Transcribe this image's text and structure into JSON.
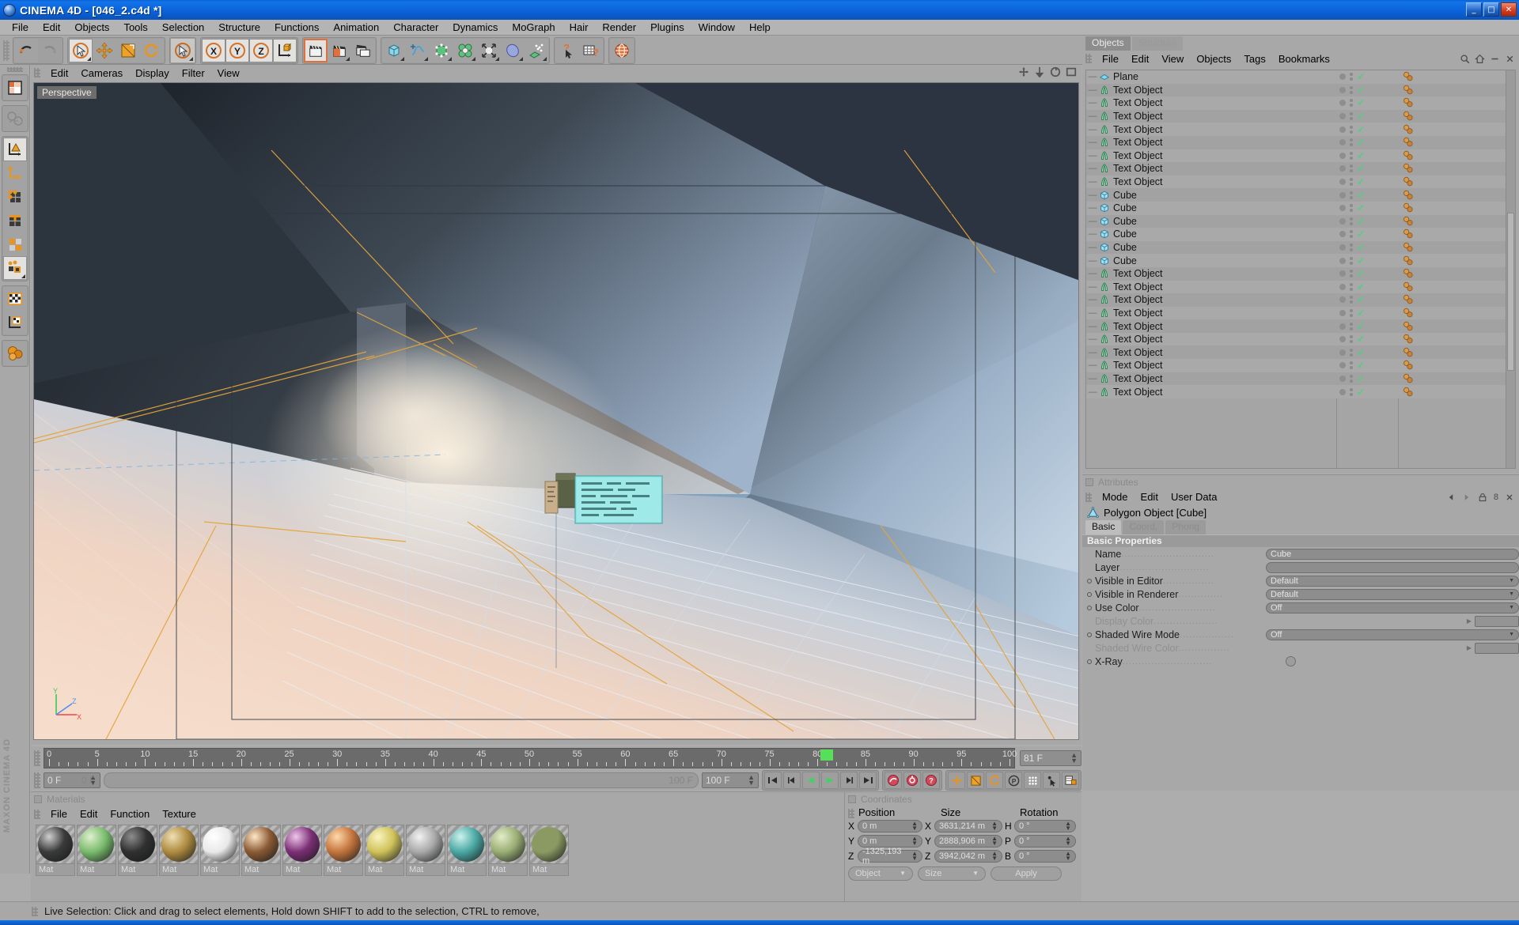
{
  "window": {
    "title": "CINEMA 4D - [046_2.c4d *]",
    "icon": "c4d-sphere-icon",
    "buttons": {
      "minimize": "_",
      "maximize": "□",
      "close": "✕"
    }
  },
  "menubar": {
    "items": [
      "File",
      "Edit",
      "Objects",
      "Tools",
      "Selection",
      "Structure",
      "Functions",
      "Animation",
      "Character",
      "Dynamics",
      "MoGraph",
      "Hair",
      "Render",
      "Plugins",
      "Window",
      "Help"
    ]
  },
  "toolbar": {
    "groups": [
      {
        "name": "history",
        "buttons": [
          {
            "name": "undo-button",
            "icon": "undo-icon",
            "state": "normal"
          },
          {
            "name": "redo-button",
            "icon": "redo-icon",
            "state": "disabled"
          }
        ]
      },
      {
        "name": "selection-tools",
        "buttons": [
          {
            "name": "live-selection-button",
            "icon": "cursor-circle-icon",
            "state": "selected",
            "has_corner": true
          },
          {
            "name": "move-button",
            "icon": "move-arrows-icon",
            "state": "normal"
          },
          {
            "name": "scale-button",
            "icon": "scale-box-icon",
            "state": "normal"
          },
          {
            "name": "rotate-button",
            "icon": "rotate-arrows-icon",
            "state": "normal"
          }
        ]
      },
      {
        "name": "active-tool",
        "buttons": [
          {
            "name": "active-tool-button",
            "icon": "cursor-circle-icon",
            "state": "highlight",
            "has_corner": true
          }
        ]
      },
      {
        "name": "axis-locks",
        "buttons": [
          {
            "name": "lock-x-button",
            "icon": "axis-x-icon",
            "state": "selected"
          },
          {
            "name": "lock-y-button",
            "icon": "axis-y-icon",
            "state": "selected"
          },
          {
            "name": "lock-z-button",
            "icon": "axis-z-icon",
            "state": "selected"
          },
          {
            "name": "world-object-coord-button",
            "icon": "world-axis-cube-icon",
            "state": "selected"
          }
        ]
      },
      {
        "name": "render-tools",
        "buttons": [
          {
            "name": "render-view-button",
            "icon": "clapper-icon",
            "state": "selected"
          },
          {
            "name": "render-region-button",
            "icon": "clapper-region-icon",
            "state": "normal",
            "has_corner": true
          },
          {
            "name": "render-settings-button",
            "icon": "clapper-settings-icon",
            "state": "normal"
          }
        ]
      },
      {
        "name": "primitives",
        "buttons": [
          {
            "name": "cube-primitive-button",
            "icon": "cube-icon",
            "state": "normal",
            "has_corner": true
          },
          {
            "name": "spline-button",
            "icon": "spline-icon",
            "state": "normal",
            "has_corner": true
          },
          {
            "name": "nurbs-button",
            "icon": "hypernurbs-icon",
            "state": "normal",
            "has_corner": true
          },
          {
            "name": "array-button",
            "icon": "array-icon",
            "state": "normal",
            "has_corner": true
          },
          {
            "name": "deformer-button",
            "icon": "deformer-icon",
            "state": "normal",
            "has_corner": true
          },
          {
            "name": "scene-object-button",
            "icon": "scene-floor-icon",
            "state": "normal",
            "has_corner": true
          },
          {
            "name": "particles-button",
            "icon": "particle-emitter-icon",
            "state": "normal",
            "has_corner": true
          }
        ]
      },
      {
        "name": "help-tools",
        "buttons": [
          {
            "name": "help-cursor-button",
            "icon": "question-cursor-icon",
            "state": "normal"
          },
          {
            "name": "structure-help-button",
            "icon": "grid-question-icon",
            "state": "normal"
          }
        ]
      },
      {
        "name": "web",
        "buttons": [
          {
            "name": "online-help-button",
            "icon": "globe-icon",
            "state": "normal"
          }
        ]
      }
    ]
  },
  "left_toolbar": {
    "buttons": [
      {
        "name": "layout-button",
        "icon": "layout-grid-icon",
        "state": "normal"
      },
      {
        "name": "undo-view-button",
        "icon": "ghost-view-icon",
        "state": "disabled"
      },
      {
        "name": "make-editable-button",
        "icon": "make-editable-icon",
        "state": "selected"
      },
      {
        "name": "object-axis-button",
        "icon": "object-axis-icon",
        "state": "normal"
      },
      {
        "name": "point-mode-button",
        "icon": "point-mode-icon",
        "state": "normal"
      },
      {
        "name": "edge-mode-button",
        "icon": "edge-mode-icon",
        "state": "normal"
      },
      {
        "name": "polygon-mode-button",
        "icon": "polygon-mode-icon",
        "state": "normal"
      },
      {
        "name": "uv-mode-button",
        "icon": "uv-mode-icon",
        "state": "selected",
        "has_corner": true
      },
      {
        "name": "texture-mode-button",
        "icon": "texture-checker-icon",
        "state": "normal"
      },
      {
        "name": "texture-axis-button",
        "icon": "texture-axis-icon",
        "state": "normal"
      },
      {
        "name": "viewport-solo-button",
        "icon": "spheres-icon",
        "state": "normal"
      }
    ],
    "branding": "MAXON CINEMA 4D"
  },
  "viewport": {
    "menu": [
      "Edit",
      "Cameras",
      "Display",
      "Filter",
      "View"
    ],
    "label": "Perspective",
    "corner_icons": [
      "pan-icon",
      "dolly-icon",
      "rotate-icon",
      "maximize-icon"
    ],
    "axis_labels": [
      "Y",
      "Z",
      "X"
    ]
  },
  "timeline": {
    "ruler_start": 0,
    "ruler_end": 100,
    "ruler_labels": [
      0,
      5,
      10,
      15,
      20,
      25,
      30,
      35,
      40,
      45,
      50,
      55,
      60,
      65,
      70,
      75,
      80,
      85,
      90,
      95,
      100
    ],
    "current_frame_marker": 81,
    "current_frame_field": "81 F",
    "start_field": "0 F",
    "start_frame_trough": "0 F",
    "end_trough": "100 F",
    "end_field": "100 F",
    "transport_buttons": [
      {
        "name": "go-to-start-button",
        "icon": "skip-back-icon"
      },
      {
        "name": "previous-keyframe-button",
        "icon": "step-back-icon"
      },
      {
        "name": "play-backward-button",
        "icon": "play-back-icon"
      },
      {
        "name": "play-forward-button",
        "icon": "play-forward-icon"
      },
      {
        "name": "next-keyframe-button",
        "icon": "step-forward-icon"
      },
      {
        "name": "go-to-end-button",
        "icon": "skip-forward-icon"
      }
    ],
    "record_buttons": [
      {
        "name": "record-active-objects-button",
        "icon": "record-icon"
      },
      {
        "name": "autokeying-button",
        "icon": "autokey-icon"
      },
      {
        "name": "keyframe-selection-button",
        "icon": "key-selection-icon"
      }
    ],
    "key_option_buttons": [
      {
        "name": "position-key-button",
        "icon": "position-key-icon"
      },
      {
        "name": "scale-key-button",
        "icon": "scale-key-icon"
      },
      {
        "name": "rotation-key-button",
        "icon": "rotation-key-icon"
      },
      {
        "name": "parameter-key-button",
        "icon": "param-key-icon"
      },
      {
        "name": "point-level-animation-button",
        "icon": "pla-icon"
      },
      {
        "name": "auto-keying-toggle",
        "icon": "autokey-cursor-icon"
      },
      {
        "name": "keyframe-mode-button",
        "icon": "keyframe-mode-icon"
      }
    ]
  },
  "materials": {
    "panel_title": "Materials",
    "menu": [
      "File",
      "Edit",
      "Function",
      "Texture"
    ],
    "items": [
      {
        "label": "Mat",
        "color": "#3a3a3a",
        "hl": "#cfcfcf"
      },
      {
        "label": "Mat",
        "color": "#79bb6c",
        "hl": "#dff0cf"
      },
      {
        "label": "Mat",
        "color": "#303030",
        "hl": "#8d8d8d"
      },
      {
        "label": "Mat",
        "color": "#ae8b3f",
        "hl": "#efe0b4"
      },
      {
        "label": "Mat",
        "color": "#e9e9e9",
        "hl": "#ffffff"
      },
      {
        "label": "Mat",
        "color": "#8a5a34",
        "hl": "#ffe7c8"
      },
      {
        "label": "Mat",
        "color": "#7b2f74",
        "hl": "#f0c6ec"
      },
      {
        "label": "Mat",
        "color": "#c3743c",
        "hl": "#ffd9ab"
      },
      {
        "label": "Mat",
        "color": "#cfc25a",
        "hl": "#fbf4c0"
      },
      {
        "label": "Mat",
        "color": "#a9a9a9",
        "hl": "#f2f2f2"
      },
      {
        "label": "Mat",
        "color": "#4aa8a3",
        "hl": "#cdf2ef"
      },
      {
        "label": "Mat",
        "color": "#9aae74",
        "hl": "#e2edc8"
      },
      {
        "label": "Mat",
        "color": "#8b9a62",
        "hl": "#8b9a62"
      }
    ]
  },
  "coordinates": {
    "panel_title": "Coordinates",
    "columns": [
      "Position",
      "Size",
      "Rotation"
    ],
    "position": {
      "x": "0 m",
      "y": "0 m",
      "z": "-1325,193 m"
    },
    "size": {
      "x": "3631,214 m",
      "y": "2888,906 m",
      "z": "3942,042 m"
    },
    "rotation": {
      "h": "0 °",
      "p": "0 °",
      "b": "0 °"
    },
    "labels": {
      "px": "X",
      "py": "Y",
      "pz": "Z",
      "sx": "X",
      "sy": "Y",
      "sz": "Z",
      "rh": "H",
      "rp": "P",
      "rb": "B"
    },
    "mode_dropdown": "Object",
    "size_dropdown": "Size",
    "apply_button": "Apply"
  },
  "objects_panel": {
    "tabs": [
      {
        "label": "Objects",
        "active": true
      },
      {
        "label": "Structure",
        "active": false
      }
    ],
    "menu": [
      "File",
      "Edit",
      "View",
      "Objects",
      "Tags",
      "Bookmarks"
    ],
    "corner_icons": [
      "search-icon",
      "home-icon",
      "minimize-icon",
      "close-icon"
    ],
    "rows": [
      {
        "name": "Plane",
        "icon": "plane-icon"
      },
      {
        "name": "Text Object",
        "icon": "text-object-icon"
      },
      {
        "name": "Text Object",
        "icon": "text-object-icon"
      },
      {
        "name": "Text Object",
        "icon": "text-object-icon"
      },
      {
        "name": "Text Object",
        "icon": "text-object-icon"
      },
      {
        "name": "Text Object",
        "icon": "text-object-icon"
      },
      {
        "name": "Text Object",
        "icon": "text-object-icon"
      },
      {
        "name": "Text Object",
        "icon": "text-object-icon"
      },
      {
        "name": "Text Object",
        "icon": "text-object-icon"
      },
      {
        "name": "Cube",
        "icon": "cube-object-icon"
      },
      {
        "name": "Cube",
        "icon": "cube-object-icon"
      },
      {
        "name": "Cube",
        "icon": "cube-object-icon"
      },
      {
        "name": "Cube",
        "icon": "cube-object-icon"
      },
      {
        "name": "Cube",
        "icon": "cube-object-icon"
      },
      {
        "name": "Cube",
        "icon": "cube-object-icon"
      },
      {
        "name": "Text Object",
        "icon": "text-object-icon"
      },
      {
        "name": "Text Object",
        "icon": "text-object-icon"
      },
      {
        "name": "Text Object",
        "icon": "text-object-icon"
      },
      {
        "name": "Text Object",
        "icon": "text-object-icon"
      },
      {
        "name": "Text Object",
        "icon": "text-object-icon"
      },
      {
        "name": "Text Object",
        "icon": "text-object-icon"
      },
      {
        "name": "Text Object",
        "icon": "text-object-icon"
      },
      {
        "name": "Text Object",
        "icon": "text-object-icon"
      },
      {
        "name": "Text Object",
        "icon": "text-object-icon"
      },
      {
        "name": "Text Object",
        "icon": "text-object-icon"
      }
    ]
  },
  "attributes": {
    "panel_title": "Attributes",
    "menu": [
      "Mode",
      "Edit",
      "User Data"
    ],
    "object_title": "Polygon Object [Cube]",
    "object_icon": "polygon-object-icon",
    "tabs": [
      {
        "label": "Basic",
        "active": true
      },
      {
        "label": "Coord,",
        "active": false
      },
      {
        "label": "Phong",
        "active": false
      }
    ],
    "section": "Basic Properties",
    "properties": [
      {
        "label": "Name",
        "value": "Cube",
        "type": "text",
        "dim": false,
        "bullet": false
      },
      {
        "label": "Layer",
        "value": "",
        "type": "text",
        "dim": false,
        "bullet": false
      },
      {
        "label": "Visible in Editor",
        "value": "Default",
        "type": "dropdown",
        "dim": false,
        "bullet": true
      },
      {
        "label": "Visible in Renderer",
        "value": "Default",
        "type": "dropdown",
        "dim": false,
        "bullet": true
      },
      {
        "label": "Use Color",
        "value": "Off",
        "type": "dropdown",
        "dim": false,
        "bullet": true
      },
      {
        "label": "Display Color",
        "value": "",
        "type": "color",
        "dim": true,
        "bullet": false
      },
      {
        "label": "Shaded Wire Mode",
        "value": "Off",
        "type": "dropdown",
        "dim": false,
        "bullet": true
      },
      {
        "label": "Shaded Wire Color",
        "value": "",
        "type": "color",
        "dim": true,
        "bullet": false
      },
      {
        "label": "X-Ray",
        "value": "",
        "type": "checkbox",
        "dim": false,
        "bullet": true
      }
    ],
    "header_icons": [
      "prev-arrow-icon",
      "next-arrow-icon",
      "lock-icon"
    ],
    "header_count": "8"
  },
  "statusbar": {
    "text": "Live Selection: Click and drag to select elements, Hold down SHIFT to add to the selection, CTRL to remove,"
  },
  "colors": {
    "chrome": "#a8a8a8",
    "accent_blue": "#1273e8",
    "orange": "#e08a2a",
    "green_key": "#56e05a",
    "field_bg": "#8d8d8d"
  }
}
